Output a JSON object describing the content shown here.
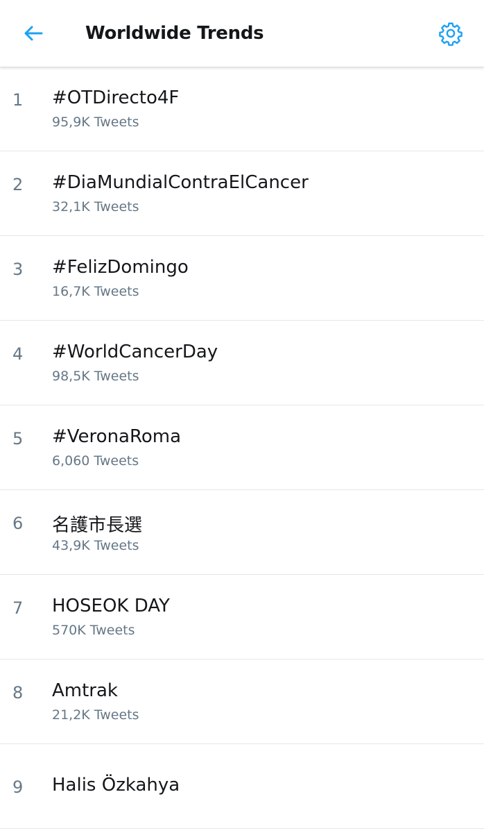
{
  "header": {
    "title": "Worldwide Trends",
    "back_icon": "arrow-left-icon",
    "settings_icon": "gear-icon",
    "accent_color": "#1da1f2"
  },
  "trends": [
    {
      "rank": "1",
      "name": "#OTDirecto4F",
      "count": "95,9K Tweets"
    },
    {
      "rank": "2",
      "name": "#DiaMundialContraElCancer",
      "count": "32,1K Tweets"
    },
    {
      "rank": "3",
      "name": "#FelizDomingo",
      "count": "16,7K Tweets"
    },
    {
      "rank": "4",
      "name": "#WorldCancerDay",
      "count": "98,5K Tweets"
    },
    {
      "rank": "5",
      "name": "#VeronaRoma",
      "count": "6,060 Tweets"
    },
    {
      "rank": "6",
      "name": "名護市長選",
      "count": "43,9K Tweets"
    },
    {
      "rank": "7",
      "name": "HOSEOK DAY",
      "count": "570K Tweets"
    },
    {
      "rank": "8",
      "name": "Amtrak",
      "count": "21,2K Tweets"
    },
    {
      "rank": "9",
      "name": "Halis Özkahya",
      "count": ""
    }
  ]
}
